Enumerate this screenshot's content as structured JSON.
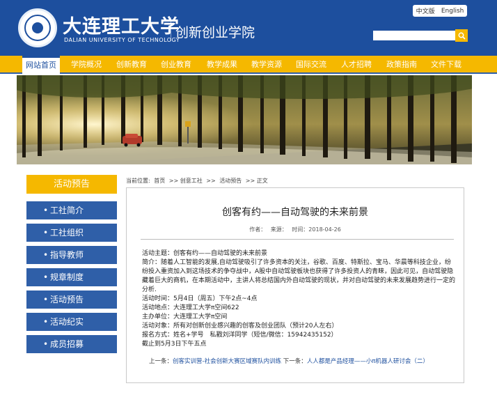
{
  "header": {
    "university_cn": "大连理工大学",
    "university_en": "DALIAN UNIVERSITY OF TECHNOLOGY",
    "college": "创新创业学院",
    "lang_cn": "中文版",
    "lang_en": "English",
    "search_placeholder": ""
  },
  "nav": {
    "items": [
      "网站首页",
      "学院概况",
      "创新教育",
      "创业教育",
      "教学成果",
      "教学资源",
      "国际交流",
      "人才招聘",
      "政策指南",
      "文件下载"
    ]
  },
  "sidebar": {
    "title": "活动预告",
    "items": [
      "工社简介",
      "工社组织",
      "指导教师",
      "规章制度",
      "活动预告",
      "活动纪实",
      "成员招募"
    ]
  },
  "breadcrumb": {
    "prefix": "当前位置:",
    "items": [
      "首页",
      ">> 创意工社",
      ">>",
      "活动预告",
      ">> 正文"
    ]
  },
  "article": {
    "title": "创客有约——自动驾驶的未来前景",
    "meta_author": "作者：",
    "meta_source": "来源：",
    "meta_time": "时间：2018-04-26",
    "lines": [
      "活动主题：创客有约——自动驾驶的未来前景",
      "简介：随着人工智能的发展,自动驾驶吸引了许多资本的关注，谷歌、百度、特斯拉、宝马、华晨等科技企业，纷纷投入重资加入到这场技术的争夺战中，A股中自动驾驶板块也获得了许多投资人的青睐，因此可见，自动驾驶隐藏着巨大的商机，在本期活动中，主讲人将总结国内外自动驾驶的现状，并对自动驾驶的未来发展趋势进行一定的分析.",
      "活动时间：5月4日（周五）下午2点~4点",
      "活动地点：大连理工大学π空间622",
      "主办单位：大连理工大学π空间",
      "活动对象：所有对创新创业感兴趣的创客及创业团队（预计20人左右）",
      "报名方式：姓名+学号　私戳刘洋同学（短信/微信：15942435152）",
      "截止到5月3日下午五点"
    ],
    "prev_label": "上一条：",
    "prev_link": "创客实训营-社会创新大赛区域赛队内训练",
    "next_label": "下一条：",
    "next_link": "人人都是产品经理——小π机器人研讨会（二）"
  },
  "colors": {
    "primary_blue": "#1d4f9e",
    "accent_yellow": "#f5b800",
    "menu_blue": "#2f5fa8"
  }
}
